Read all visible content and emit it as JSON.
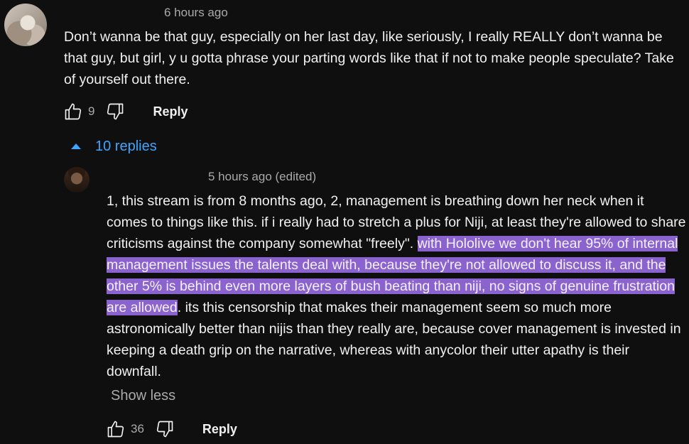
{
  "top_comment": {
    "timestamp": "6 hours ago",
    "text": "Don’t wanna be that guy, especially on her last day, like seriously, I really REALLY don’t wanna be that guy, but girl, y u gotta phrase your parting words like that if not to make people speculate? Take of yourself out there.",
    "like_count": "9",
    "reply_label": "Reply",
    "like_icon": "thumbs-up-icon",
    "dislike_icon": "thumbs-down-icon"
  },
  "replies_toggle": {
    "label": "10 replies",
    "icon": "caret-up-icon",
    "color": "#3ea6ff"
  },
  "reply": {
    "timestamp": "5 hours ago (edited)",
    "text_before": "1, this stream is from 8 months ago, 2, management is breathing down her neck when it comes to things like this. if i really had to stretch a plus for Niji, at least they're allowed to share criticisms against the company somewhat \"freely\". ",
    "text_highlighted": "with Hololive we don't hear 95% of internal management issues the talents deal with, because they're not allowed to discuss it, and the other 5% is behind even more layers of bush beating than niji, no signs of genuine frustration are allowed",
    "text_after": ". its this censorship that makes their management seem so much more astronomically better than nijis than they really are, because cover management is invested in keeping a death grip on the narrative, whereas with anycolor their utter apathy is their downfall.",
    "show_less_label": "Show less",
    "like_count": "36",
    "reply_label": "Reply",
    "highlight_color": "#8b63cf"
  }
}
